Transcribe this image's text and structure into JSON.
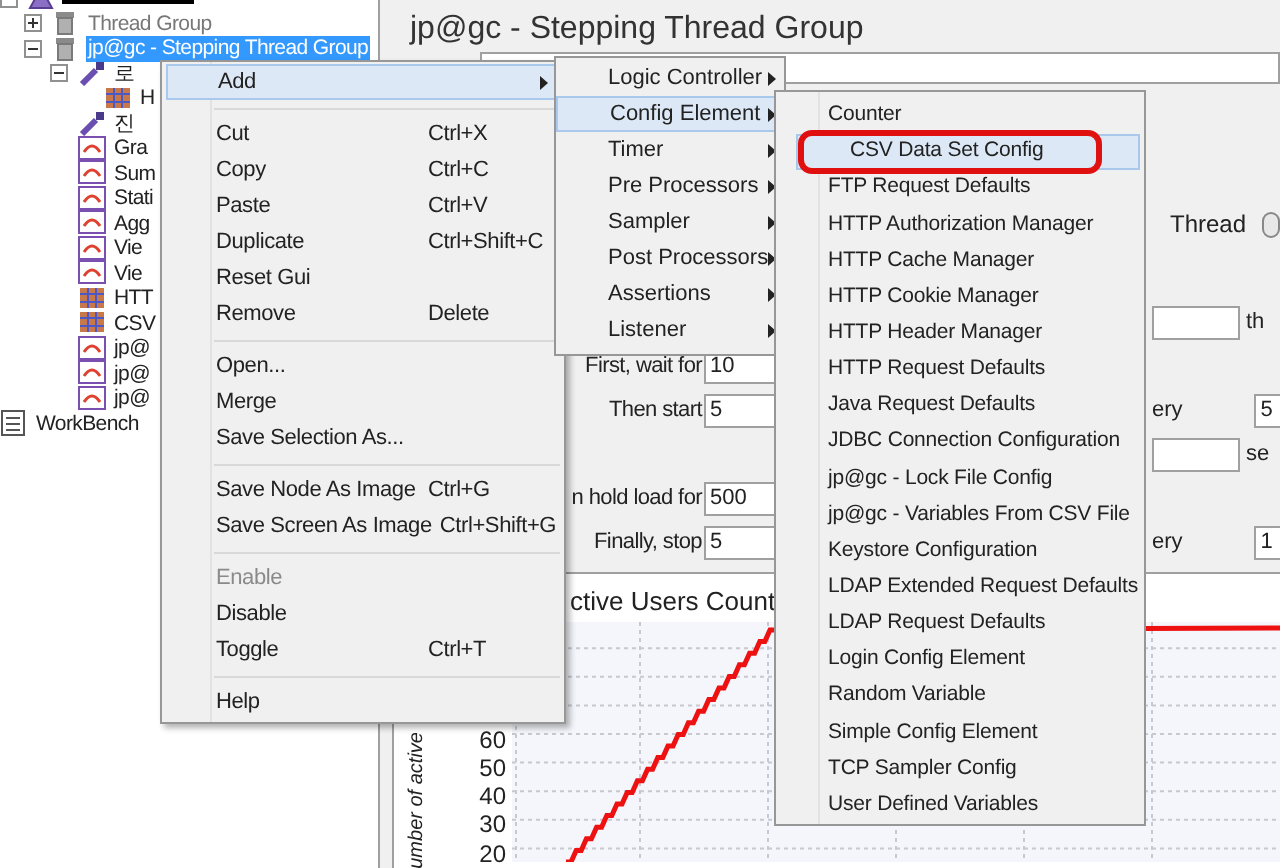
{
  "tree": {
    "items": [
      {
        "kind": "test-plan",
        "redacted": true,
        "expanded": true,
        "children": [
          {
            "kind": "thread-group",
            "label": "Thread Group",
            "expanded": false,
            "dimmed": true,
            "selected": false
          },
          {
            "kind": "thread-group",
            "label": "jp@gc - Stepping Thread Group",
            "expanded": true,
            "selected": true,
            "children": [
              {
                "kind": "pipette",
                "label": "로",
                "expanded": true,
                "selected": false,
                "children": [
                  {
                    "kind": "config",
                    "label": "H",
                    "selected": false
                  }
                ]
              },
              {
                "kind": "pipette",
                "label": "진",
                "selected": false
              },
              {
                "kind": "listener",
                "label": "Gra",
                "selected": false
              },
              {
                "kind": "listener",
                "label": "Sum",
                "selected": false
              },
              {
                "kind": "listener",
                "label": "Stati",
                "selected": false
              },
              {
                "kind": "listener",
                "label": "Agg",
                "selected": false
              },
              {
                "kind": "listener",
                "label": "Vie",
                "selected": false
              },
              {
                "kind": "listener",
                "label": "Vie",
                "selected": false
              },
              {
                "kind": "config",
                "label": "HTT",
                "selected": false
              },
              {
                "kind": "config",
                "label": "CSV",
                "selected": false
              },
              {
                "kind": "listener",
                "label": "jp@",
                "selected": false
              },
              {
                "kind": "listener",
                "label": "jp@",
                "selected": false
              },
              {
                "kind": "listener",
                "label": "jp@",
                "selected": false
              }
            ]
          }
        ]
      },
      {
        "kind": "workbench",
        "label": "WorkBench",
        "selected": false
      }
    ]
  },
  "panel": {
    "title": "jp@gc - Stepping Thread Group",
    "radio_option": {
      "label": "Thread",
      "selected": false
    },
    "rows": [
      {
        "right": {
          "kind": "field",
          "suffix": "th"
        }
      },
      {
        "left": {
          "label": "First, wait for",
          "value": "10"
        }
      },
      {
        "left": {
          "label": "Then start",
          "value": "5"
        },
        "right": {
          "kind": "label-field",
          "label": "ery",
          "value": "5"
        }
      },
      {
        "right": {
          "kind": "field",
          "suffix": "se"
        }
      },
      {
        "left": {
          "label": "n hold load for",
          "value": "500"
        }
      },
      {
        "left": {
          "label": "Finally, stop",
          "value": "5"
        },
        "right": {
          "kind": "label-field",
          "label": "ery",
          "value": "1"
        }
      }
    ],
    "chart": {
      "title": "ctive Users Count",
      "ylabel": "umber of active",
      "y_tick_labels": [
        "60",
        "50",
        "40",
        "30",
        "20"
      ]
    }
  },
  "context_menu": {
    "items": [
      {
        "kind": "item",
        "label": "Add",
        "has_submenu": true,
        "selected": true,
        "disabled": false
      },
      {
        "kind": "separator"
      },
      {
        "kind": "item",
        "label": "Cut",
        "shortcut": "Ctrl+X",
        "selected": false,
        "disabled": false
      },
      {
        "kind": "item",
        "label": "Copy",
        "shortcut": "Ctrl+C",
        "selected": false,
        "disabled": false
      },
      {
        "kind": "item",
        "label": "Paste",
        "shortcut": "Ctrl+V",
        "selected": false,
        "disabled": false
      },
      {
        "kind": "item",
        "label": "Duplicate",
        "shortcut": "Ctrl+Shift+C",
        "selected": false,
        "disabled": false
      },
      {
        "kind": "item",
        "label": "Reset Gui",
        "selected": false,
        "disabled": false
      },
      {
        "kind": "item",
        "label": "Remove",
        "shortcut": "Delete",
        "selected": false,
        "disabled": false
      },
      {
        "kind": "separator"
      },
      {
        "kind": "item",
        "label": "Open...",
        "selected": false,
        "disabled": false
      },
      {
        "kind": "item",
        "label": "Merge",
        "selected": false,
        "disabled": false
      },
      {
        "kind": "item",
        "label": "Save Selection As...",
        "selected": false,
        "disabled": false
      },
      {
        "kind": "separator"
      },
      {
        "kind": "item",
        "label": "Save Node As Image",
        "shortcut": "Ctrl+G",
        "selected": false,
        "disabled": false
      },
      {
        "kind": "item",
        "label": "Save Screen As Image",
        "shortcut": "Ctrl+Shift+G",
        "selected": false,
        "disabled": false
      },
      {
        "kind": "separator"
      },
      {
        "kind": "item",
        "label": "Enable",
        "selected": false,
        "disabled": true
      },
      {
        "kind": "item",
        "label": "Disable",
        "selected": false,
        "disabled": false
      },
      {
        "kind": "item",
        "label": "Toggle",
        "shortcut": "Ctrl+T",
        "selected": false,
        "disabled": false
      },
      {
        "kind": "separator"
      },
      {
        "kind": "item",
        "label": "Help",
        "selected": false,
        "disabled": false
      }
    ]
  },
  "add_submenu": {
    "items": [
      {
        "label": "Logic Controller",
        "selected": false,
        "has_submenu": true
      },
      {
        "label": "Config Element",
        "selected": true,
        "has_submenu": true
      },
      {
        "label": "Timer",
        "selected": false,
        "has_submenu": true
      },
      {
        "label": "Pre Processors",
        "selected": false,
        "has_submenu": true
      },
      {
        "label": "Sampler",
        "selected": false,
        "has_submenu": true
      },
      {
        "label": "Post Processors",
        "selected": false,
        "has_submenu": true
      },
      {
        "label": "Assertions",
        "selected": false,
        "has_submenu": true
      },
      {
        "label": "Listener",
        "selected": false,
        "has_submenu": true
      }
    ]
  },
  "config_submenu": {
    "items": [
      {
        "label": "Counter",
        "selected": false,
        "circled": false
      },
      {
        "label": "CSV Data Set Config",
        "selected": true,
        "circled": true
      },
      {
        "label": "FTP Request Defaults",
        "selected": false,
        "circled": false
      },
      {
        "label": "HTTP Authorization Manager",
        "selected": false,
        "circled": false
      },
      {
        "label": "HTTP Cache Manager",
        "selected": false,
        "circled": false
      },
      {
        "label": "HTTP Cookie Manager",
        "selected": false,
        "circled": false
      },
      {
        "label": "HTTP Header Manager",
        "selected": false,
        "circled": false
      },
      {
        "label": "HTTP Request Defaults",
        "selected": false,
        "circled": false
      },
      {
        "label": "Java Request Defaults",
        "selected": false,
        "circled": false
      },
      {
        "label": "JDBC Connection Configuration",
        "selected": false,
        "circled": false
      },
      {
        "label": "jp@gc - Lock File Config",
        "selected": false,
        "circled": false
      },
      {
        "label": "jp@gc - Variables From CSV File",
        "selected": false,
        "circled": false
      },
      {
        "label": "Keystore Configuration",
        "selected": false,
        "circled": false
      },
      {
        "label": "LDAP Extended Request Defaults",
        "selected": false,
        "circled": false
      },
      {
        "label": "LDAP Request Defaults",
        "selected": false,
        "circled": false
      },
      {
        "label": "Login Config Element",
        "selected": false,
        "circled": false
      },
      {
        "label": "Random Variable",
        "selected": false,
        "circled": false
      },
      {
        "label": "Simple Config Element",
        "selected": false,
        "circled": false
      },
      {
        "label": "TCP Sampler Config",
        "selected": false,
        "circled": false
      },
      {
        "label": "User Defined Variables",
        "selected": false,
        "circled": false
      }
    ]
  }
}
